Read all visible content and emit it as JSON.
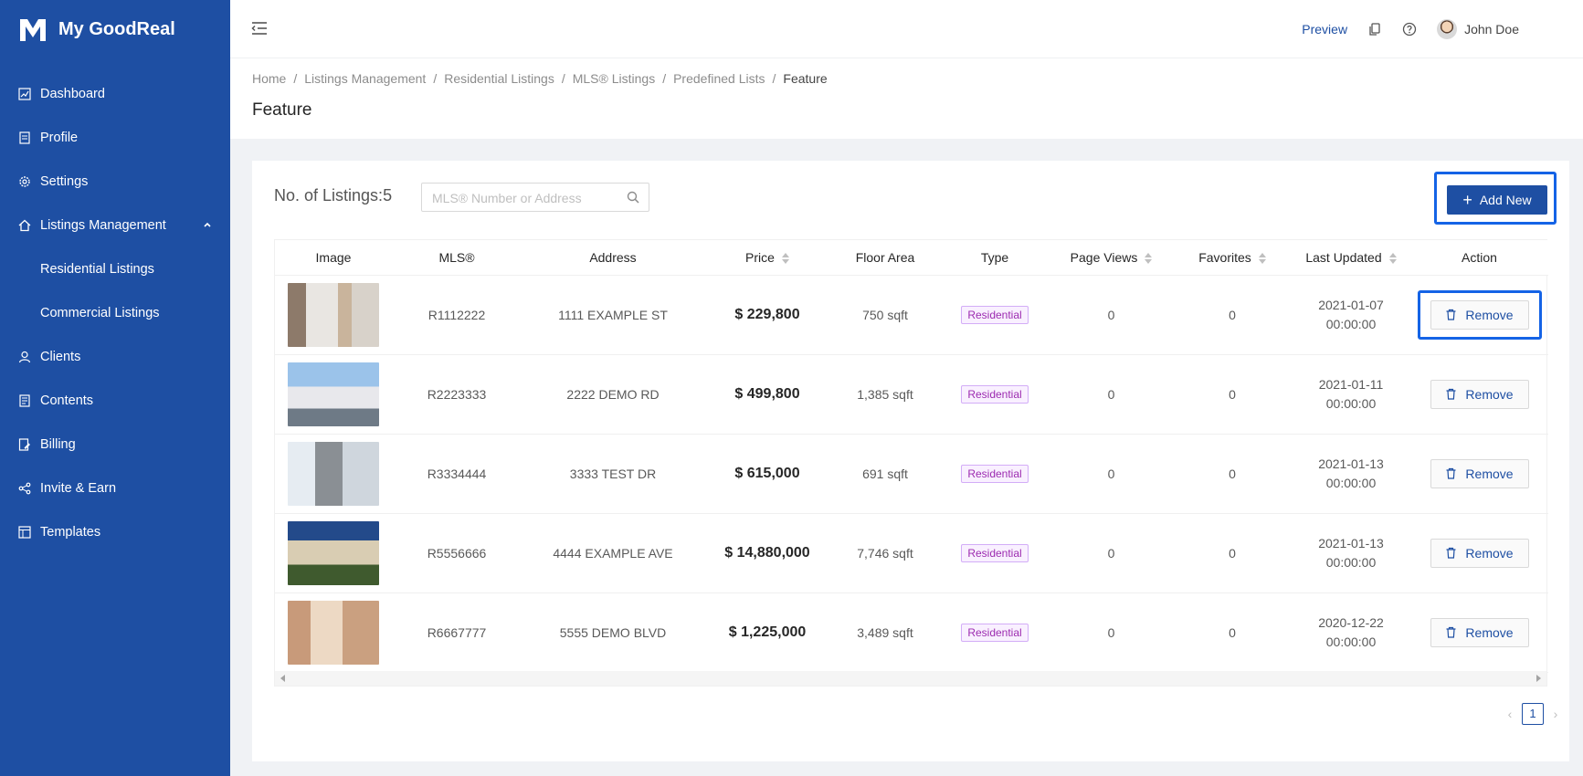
{
  "app": {
    "name": "My GoodReal"
  },
  "sidebar": {
    "items": [
      {
        "label": "Dashboard",
        "icon": "chart-icon"
      },
      {
        "label": "Profile",
        "icon": "profile-card-icon"
      },
      {
        "label": "Settings",
        "icon": "gear-icon"
      },
      {
        "label": "Listings Management",
        "icon": "home-icon",
        "expanded": true
      },
      {
        "label": "Residential Listings",
        "sub": true
      },
      {
        "label": "Commercial Listings",
        "sub": true
      },
      {
        "label": "Clients",
        "icon": "user-icon"
      },
      {
        "label": "Contents",
        "icon": "document-icon"
      },
      {
        "label": "Billing",
        "icon": "billing-icon"
      },
      {
        "label": "Invite & Earn",
        "icon": "share-icon"
      },
      {
        "label": "Templates",
        "icon": "template-icon"
      }
    ]
  },
  "header": {
    "preview_label": "Preview",
    "user_name": "John Doe"
  },
  "breadcrumb": [
    "Home",
    "Listings Management",
    "Residential Listings",
    "MLS® Listings",
    "Predefined Lists",
    "Feature"
  ],
  "page_title": "Feature",
  "listing_count": {
    "label": "No. of Listings:",
    "value": "5"
  },
  "search": {
    "placeholder": "MLS® Number or Address"
  },
  "add_button_label": "Add New",
  "table": {
    "columns": [
      "Image",
      "MLS®",
      "Address",
      "Price",
      "Floor Area",
      "Type",
      "Page Views",
      "Favorites",
      "Last Updated",
      "Action"
    ],
    "sortable": [
      "Price",
      "Page Views",
      "Favorites",
      "Last Updated"
    ],
    "rows": [
      {
        "mls": "R1112222",
        "address": "1111 EXAMPLE ST",
        "price": "$ 229,800",
        "area": "750 sqft",
        "type": "Residential",
        "views": "0",
        "favorites": "0",
        "date": "2021-01-07",
        "time": "00:00:00",
        "action": "Remove"
      },
      {
        "mls": "R2223333",
        "address": "2222 DEMO RD",
        "price": "$ 499,800",
        "area": "1,385 sqft",
        "type": "Residential",
        "views": "0",
        "favorites": "0",
        "date": "2021-01-11",
        "time": "00:00:00",
        "action": "Remove"
      },
      {
        "mls": "R3334444",
        "address": "3333 TEST DR",
        "price": "$ 615,000",
        "area": "691 sqft",
        "type": "Residential",
        "views": "0",
        "favorites": "0",
        "date": "2021-01-13",
        "time": "00:00:00",
        "action": "Remove"
      },
      {
        "mls": "R5556666",
        "address": "4444 EXAMPLE AVE",
        "price": "$ 14,880,000",
        "area": "7,746 sqft",
        "type": "Residential",
        "views": "0",
        "favorites": "0",
        "date": "2021-01-13",
        "time": "00:00:00",
        "action": "Remove"
      },
      {
        "mls": "R6667777",
        "address": "5555 DEMO BLVD",
        "price": "$ 1,225,000",
        "area": "3,489 sqft",
        "type": "Residential",
        "views": "0",
        "favorites": "0",
        "date": "2020-12-22",
        "time": "00:00:00",
        "action": "Remove"
      }
    ]
  },
  "pagination": {
    "current": "1"
  },
  "colors": {
    "brand": "#1e4fa3",
    "highlight": "#1463e6",
    "tag": "#9c2bb0"
  }
}
